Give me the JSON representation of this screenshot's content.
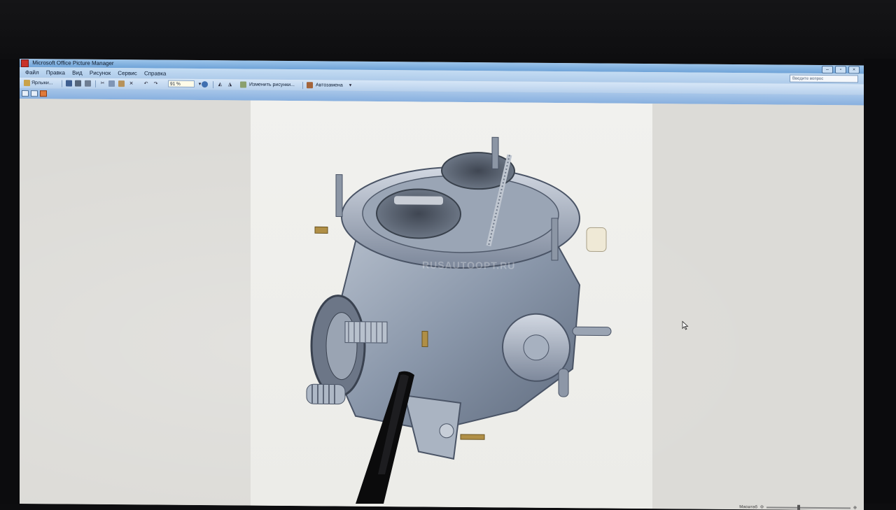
{
  "window": {
    "title": "Microsoft Office Picture Manager"
  },
  "menu": {
    "items": [
      "Файл",
      "Правка",
      "Вид",
      "Рисунок",
      "Сервис",
      "Справка"
    ],
    "help_placeholder": "Введите вопрос"
  },
  "toolbar": {
    "shortcuts_label": "Ярлыки...",
    "zoom_value": "91 %",
    "edit_pictures_label": "Изменить рисунки...",
    "autocorrect_label": "Автозамена"
  },
  "picture": {
    "subject": "carburetor",
    "watermark": "RUSAUTOOPT.RU"
  },
  "statusbar": {
    "zoom_label": "Масштаб"
  },
  "colors": {
    "title_gradient_top": "#9cc4ea",
    "menu_bg": "#c4dcf3",
    "workspace_bg": "#dcdbd7"
  }
}
